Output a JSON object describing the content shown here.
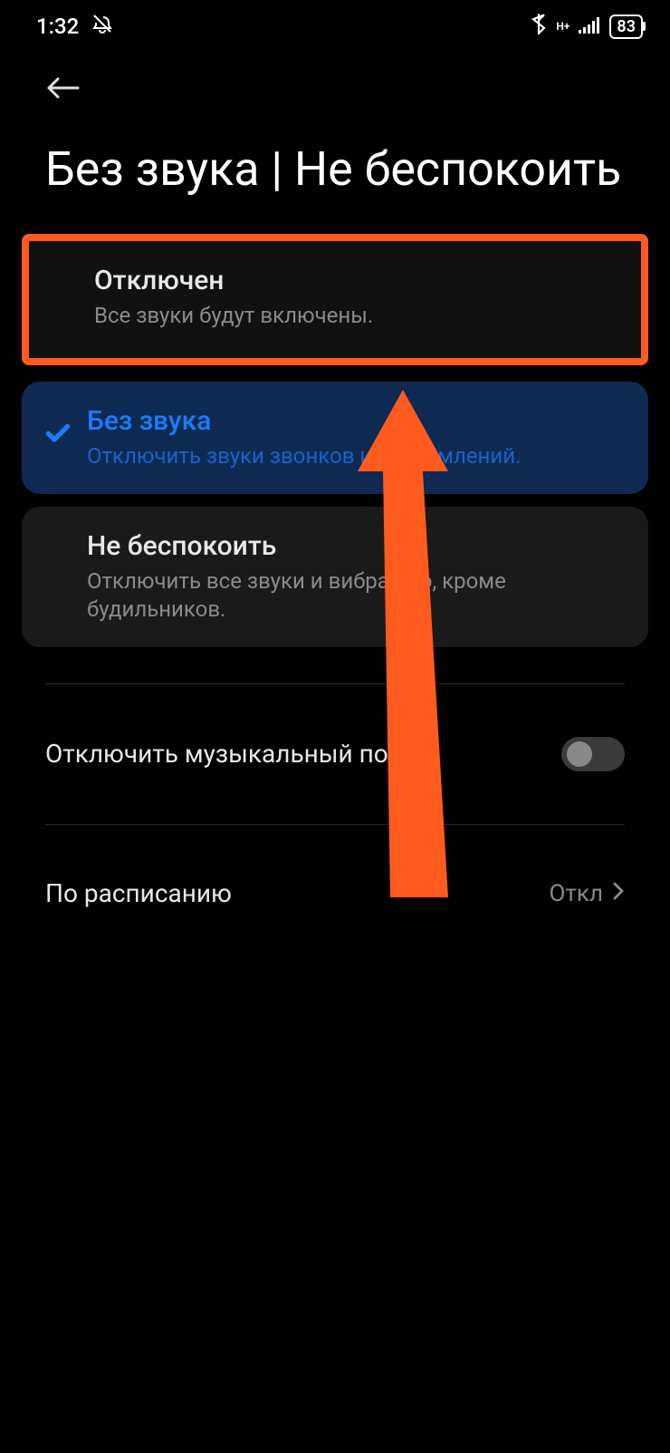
{
  "status": {
    "time": "1:32",
    "battery": "83",
    "network_label": "H+"
  },
  "page": {
    "title": "Без звука | Не беспокоить"
  },
  "options": [
    {
      "title": "Отключен",
      "desc": "Все звуки будут включены."
    },
    {
      "title": "Без звука",
      "desc": "Отключить звуки звонков и уведомлений."
    },
    {
      "title": "Не беспокоить",
      "desc": "Отключить все звуки и вибрацию, кроме будильников."
    }
  ],
  "settings": {
    "mute_stream_label": "Отключить музыкальный поток",
    "schedule_label": "По расписанию",
    "schedule_value": "Откл"
  }
}
